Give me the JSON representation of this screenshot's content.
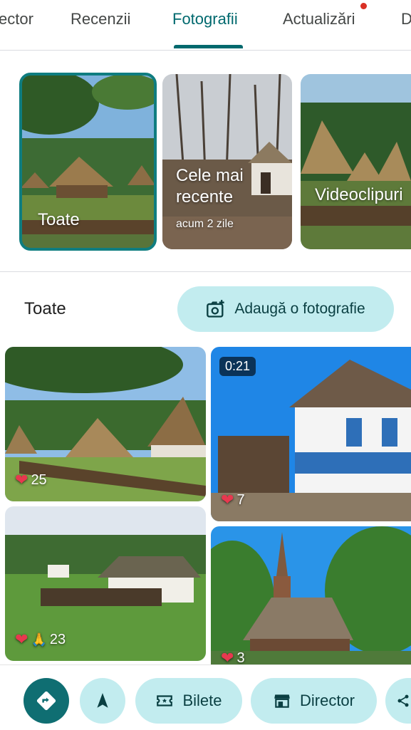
{
  "tabs": [
    {
      "label": "ector"
    },
    {
      "label": "Recenzii"
    },
    {
      "label": "Fotografii"
    },
    {
      "label": "Actualizări"
    },
    {
      "label": "D"
    }
  ],
  "albums": [
    {
      "label": "Toate"
    },
    {
      "label": "Cele mai recente",
      "sub": "acum 2 zile"
    },
    {
      "label": "Videoclipuri"
    }
  ],
  "section": {
    "title": "Toate",
    "add_photo_label": "Adaugă o fotografie"
  },
  "photos": [
    {
      "likes": "25",
      "duration": ""
    },
    {
      "likes": "7",
      "duration": "0:21"
    },
    {
      "likes": "23",
      "duration": ""
    },
    {
      "likes": "3",
      "duration": ""
    }
  ],
  "actions": {
    "tickets_label": "Bilete",
    "directory_label": "Director"
  },
  "colors": {
    "accent": "#00696e",
    "tonal_button": "#c2ecef",
    "notification": "#d93025",
    "heart": "#e8384f"
  }
}
